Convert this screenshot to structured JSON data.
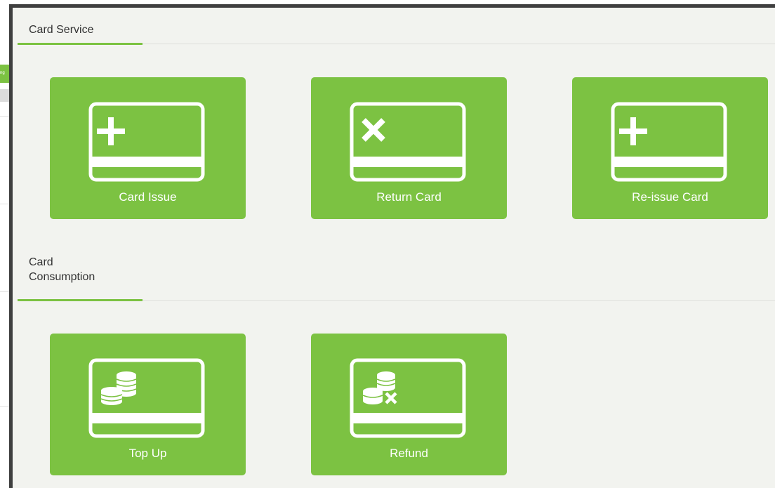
{
  "background_app": {
    "green_tab_fragment": "ng"
  },
  "sections": [
    {
      "title": "Card Service",
      "tiles": [
        {
          "label": "Card Issue",
          "icon": "card-add-icon"
        },
        {
          "label": "Return Card",
          "icon": "card-remove-icon"
        },
        {
          "label": "Re-issue Card",
          "icon": "card-reissue-icon"
        }
      ]
    },
    {
      "title_line1": "Card",
      "title_line2": "Consumption",
      "tiles": [
        {
          "label": "Top Up",
          "icon": "card-coins-icon"
        },
        {
          "label": "Refund",
          "icon": "card-coins-refund-icon"
        }
      ]
    }
  ],
  "colors": {
    "accent_green": "#7cc242",
    "modal_background": "#f2f3ef",
    "modal_border": "#3f3f3f",
    "title_text": "#333333"
  }
}
